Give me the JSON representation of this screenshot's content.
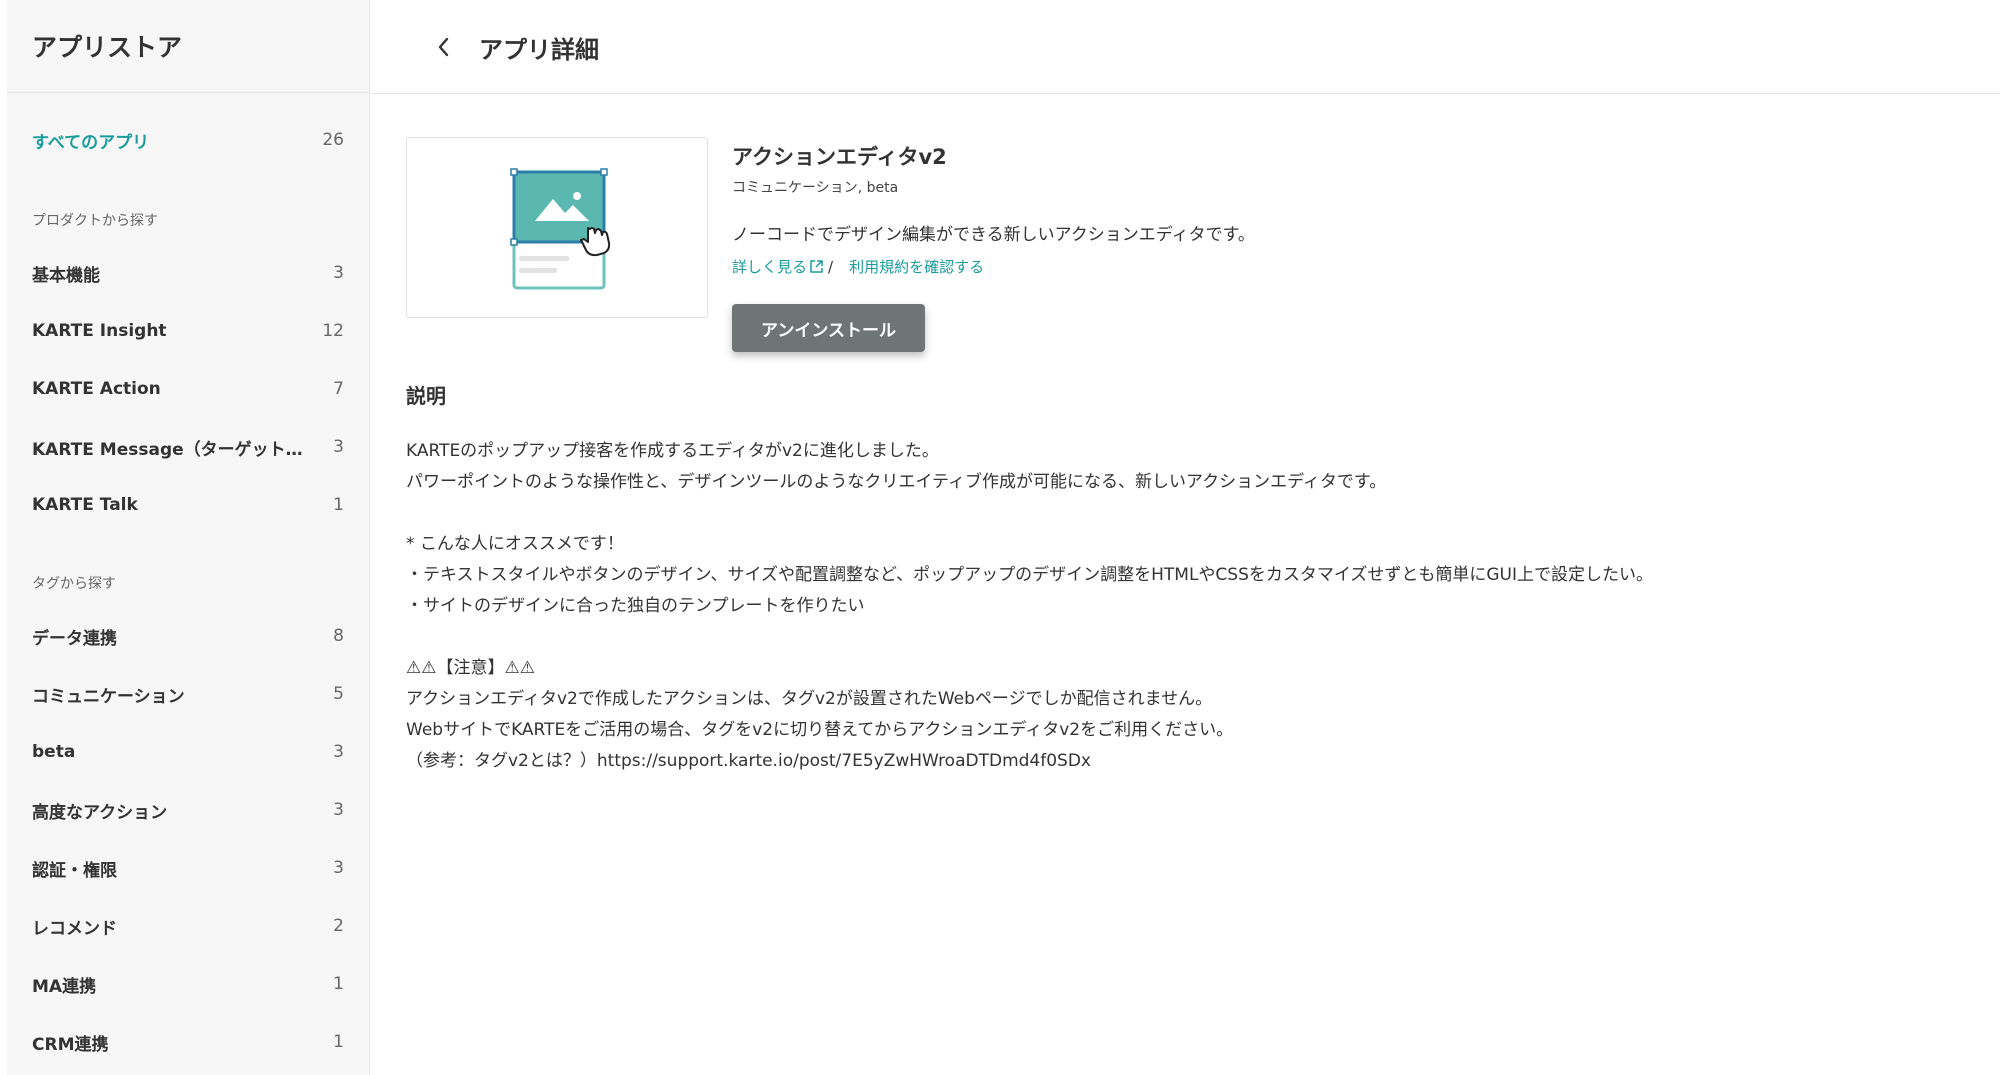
{
  "sidebar": {
    "title": "アプリストア",
    "all_apps": {
      "label": "すべてのアプリ",
      "count": "26"
    },
    "product_section": "プロダクトから探す",
    "products": [
      {
        "label": "基本機能",
        "count": "3"
      },
      {
        "label": "KARTE Insight",
        "count": "12"
      },
      {
        "label": "KARTE Action",
        "count": "7"
      },
      {
        "label": "KARTE Message（ターゲット配信）",
        "count": "3"
      },
      {
        "label": "KARTE Talk",
        "count": "1"
      }
    ],
    "tag_section": "タグから探す",
    "tags": [
      {
        "label": "データ連携",
        "count": "8"
      },
      {
        "label": "コミュニケーション",
        "count": "5"
      },
      {
        "label": "beta",
        "count": "3"
      },
      {
        "label": "高度なアクション",
        "count": "3"
      },
      {
        "label": "認証・権限",
        "count": "3"
      },
      {
        "label": "レコメンド",
        "count": "2"
      },
      {
        "label": "MA連携",
        "count": "1"
      },
      {
        "label": "CRM連携",
        "count": "1"
      }
    ]
  },
  "header": {
    "title": "アプリ詳細"
  },
  "app": {
    "name": "アクションエディタv2",
    "tags": "コミュニケーション, beta",
    "description": "ノーコードでデザイン編集ができる新しいアクションエディタです。",
    "learn_more": "詳しく見る",
    "separator": "/",
    "terms": "利用規約を確認する",
    "uninstall": "アンインストール"
  },
  "details": {
    "section_title": "説明",
    "lines": [
      "KARTEのポップアップ接客を作成するエディタがv2に進化しました。",
      "パワーポイントのような操作性と、デザインツールのようなクリエイティブ作成が可能になる、新しいアクションエディタです。",
      "",
      "* こんな人にオススメです！",
      "・テキストスタイルやボタンのデザイン、サイズや配置調整など、ポップアップのデザイン調整をHTMLやCSSをカスタマイズせずとも簡単にGUI上で設定したい。",
      "・サイトのデザインに合った独自のテンプレートを作りたい",
      "",
      "⚠⚠【注意】⚠⚠",
      "アクションエディタv2で作成したアクションは、タグv2が設置されたWebページでしか配信されません。",
      "WebサイトでKARTEをご活用の場合、タグをv2に切り替えてからアクションエディタv2をご利用ください。",
      "（参考：タグv2とは？）https://support.karte.io/post/7E5yZwHWroaDTDmd4f0SDx"
    ]
  },
  "colors": {
    "accent": "#1a9c9c",
    "button": "#6e7574",
    "sidebar_bg": "#f7f7f7"
  }
}
